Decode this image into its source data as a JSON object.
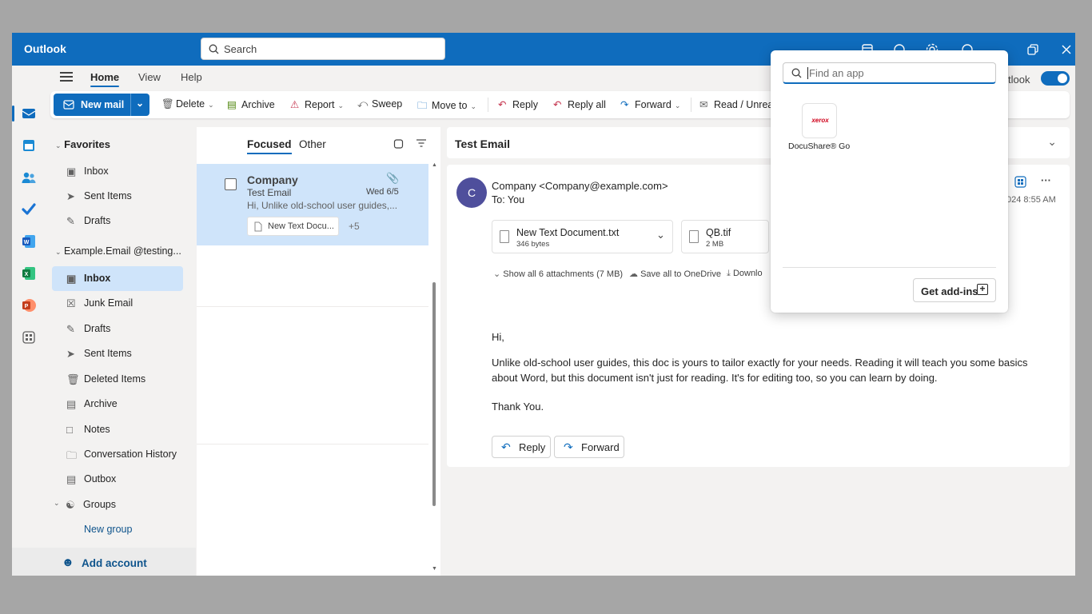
{
  "app": {
    "title": "Outlook"
  },
  "search": {
    "placeholder": "Search"
  },
  "menu": {
    "tabs": [
      "Home",
      "View",
      "Help"
    ],
    "toggle_label": "tlook"
  },
  "ribbon": {
    "new_mail": "New mail",
    "delete": "Delete",
    "archive": "Archive",
    "report": "Report",
    "sweep": "Sweep",
    "move_to": "Move to",
    "reply": "Reply",
    "reply_all": "Reply all",
    "forward": "Forward",
    "read_unread": "Read / Unrea"
  },
  "folders": {
    "favorites_label": "Favorites",
    "favorites": [
      "Inbox",
      "Sent Items",
      "Drafts"
    ],
    "account_label": "Example.Email @testing...",
    "account_items": [
      "Inbox",
      "Junk Email",
      "Drafts",
      "Sent Items",
      "Deleted Items",
      "Archive",
      "Notes",
      "Conversation History",
      "Outbox"
    ],
    "groups_label": "Groups",
    "new_group": "New group",
    "add_account": "Add account"
  },
  "message_list": {
    "tabs": [
      "Focused",
      "Other"
    ],
    "message": {
      "from": "Company",
      "subject": "Test Email",
      "date": "Wed 6/5",
      "preview": "Hi, Unlike old-school user guides,...",
      "attachment_chip": "New Text Docu...",
      "more_count": "+5"
    }
  },
  "reading_pane": {
    "subject": "Test Email",
    "avatar_initial": "C",
    "sender": "Company <Company@example.com>",
    "to": "To:  You",
    "timestamp_partial": "024 8:55 AM",
    "attachments": [
      {
        "name": "New Text Document.txt",
        "size": "346 bytes"
      },
      {
        "name": "QB.tif",
        "size": "2 MB"
      }
    ],
    "show_all": "Show all 6 attachments (7 MB)",
    "save_all": "Save all to OneDrive",
    "download": "Downlo",
    "body": {
      "greeting": "Hi,",
      "paragraph_line1": "Unlike old-school user guides, this doc is yours to tailor exactly for your needs. Reading it will teach you some basics",
      "paragraph_line2": "about Word, but this document isn't just for reading. It's for editing too, so you can learn by doing.",
      "closing": "Thank You."
    },
    "reply_button": "Reply",
    "forward_button": "Forward"
  },
  "apps_popup": {
    "find_placeholder": "Find an app",
    "apps": [
      {
        "name": "DocuShare® Go",
        "logo_text": "xerox"
      }
    ],
    "get_addins": "Get add-ins"
  },
  "colors": {
    "brand": "#0f6cbd",
    "selected_bg": "#cfe4fa"
  }
}
